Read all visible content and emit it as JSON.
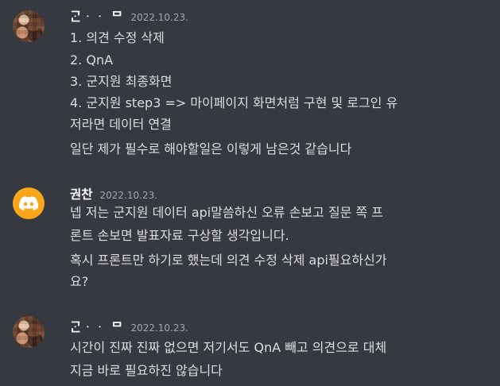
{
  "messages": [
    {
      "author": "ᄀᆞᆫᆞᆞ ᄆ",
      "timestamp": "2022.10.23.",
      "lines": [
        "1. 의견 수정 삭제",
        "2. QnA",
        "3. 군지원 최종화면",
        "4. 군지원 step3 => 마이페이지 화면처럼 구현 및 로그인 유",
        "저라면 데이터 연결",
        "일단 제가 필수로 해야할일은 이렇게 남은것 같습니다"
      ]
    },
    {
      "author": "권찬",
      "timestamp": "2022.10.23.",
      "lines": [
        "넵 저는 군지원 데이터 api말씀하신 오류 손보고 질문 쪽 프",
        "론트 손보면 발표자료 구상할 생각입니다.",
        "혹시 프론트만 하기로 했는데 의견 수정 삭제 api필요하신가",
        "요?"
      ]
    },
    {
      "author": "ᄀᆞᆫᆞᆞ ᄆ",
      "timestamp": "2022.10.23.",
      "lines": [
        "시간이 진짜 진짜 없으면 저기서도 QnA 빼고 의견으로 대체",
        "지금 바로 필요하진 않습니다"
      ]
    }
  ],
  "colors": {
    "background": "#36393f",
    "text": "#dcddde",
    "username": "#ffffff",
    "timestamp": "#a3a6aa",
    "discord_avatar": "#faa61a"
  },
  "icons": {
    "discord_avatar": "discord-logo-icon"
  }
}
